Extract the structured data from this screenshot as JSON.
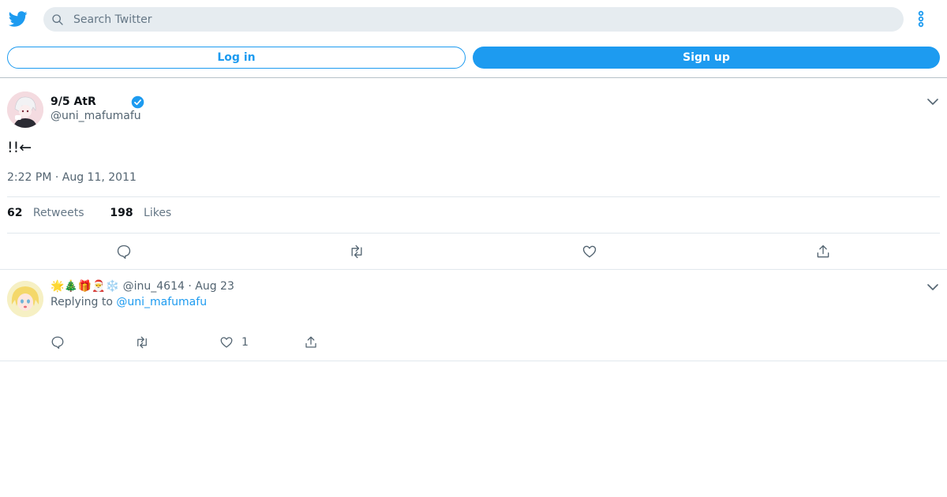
{
  "colors": {
    "brand": "#1d9bf0",
    "text": "#0f1419",
    "muted": "#536471",
    "searchBg": "#e6ecf0"
  },
  "header": {
    "logo_icon": "twitter-bird-icon",
    "search": {
      "placeholder": "Search Twitter",
      "value": ""
    },
    "more_icon": "more-vertical-icon"
  },
  "auth": {
    "login_label": "Log in",
    "signup_label": "Sign up"
  },
  "tweet": {
    "display_name": "9/5 AtR",
    "handle": "@uni_mafumafu",
    "text": "!!←",
    "timestamp": "2:22 PM · Aug 11, 2011",
    "retweets_count": "62",
    "retweets_label": "Retweets",
    "likes_count": "198",
    "likes_label": "Likes"
  },
  "reply": {
    "display_emojis": "🌟🎄🎁🎅❄️",
    "handle": "@inu_4614",
    "separator": "·",
    "date": "Aug 23",
    "replying_to_label": "Replying to",
    "replying_to_handle": "@uni_mafumafu",
    "like_count": "1"
  }
}
